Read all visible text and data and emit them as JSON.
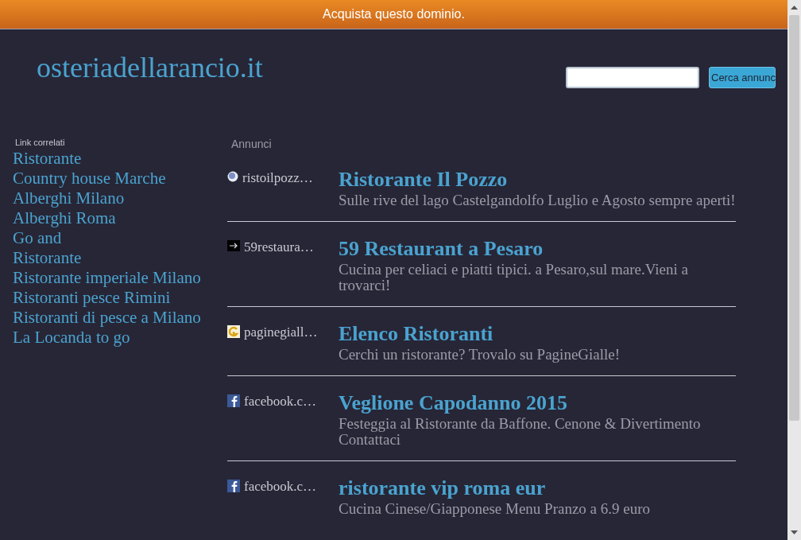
{
  "banner": {
    "label": "Acquista questo dominio."
  },
  "site_title": "osteriadellarancio.it",
  "search": {
    "button": "Cerca annunc"
  },
  "related": {
    "heading": "Link correlati",
    "links": [
      "Ristorante",
      "Country house Marche",
      "Alberghi Milano",
      "Alberghi Roma",
      "Go and",
      "Ristorante",
      "Ristorante imperiale Milano",
      "Ristoranti pesce Rimini",
      "Ristoranti di pesce a Milano",
      "La Locanda to go"
    ]
  },
  "ads": {
    "heading": "Annunci",
    "items": [
      {
        "kind": "globe",
        "source": "ristoilpozz…",
        "title": "Ristorante Il Pozzo",
        "description": "Sulle rive del lago Castelgandolfo Luglio e Agosto sempre aperti!"
      },
      {
        "kind": "arrow",
        "source": "59restaura…",
        "title": "59 Restaurant a Pesaro",
        "description": "Cucina per celiaci e piatti tipici. a Pesaro,sul mare.Vieni a trovarci!"
      },
      {
        "kind": "g",
        "source": "paginegiall…",
        "title": "Elenco Ristoranti",
        "description": "Cerchi un ristorante? Trovalo su PagineGialle!"
      },
      {
        "kind": "facebook",
        "source": "facebook.c…",
        "title": "Veglione Capodanno 2015",
        "description": "Festeggia al Ristorante da Baffone. Cenone & Divertimento Contattaci"
      },
      {
        "kind": "facebook",
        "source": "facebook.c…",
        "title": "ristorante vip roma eur",
        "description": "Cucina Cinese/Giapponese Menu Pranzo a 6.9 euro"
      }
    ]
  }
}
